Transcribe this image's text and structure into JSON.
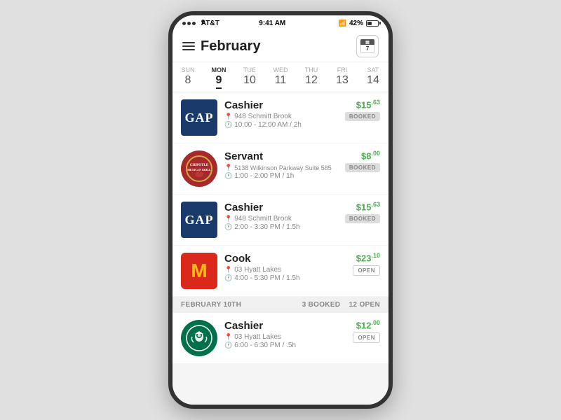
{
  "statusBar": {
    "carrier": "AT&T",
    "time": "9:41 AM",
    "bluetooth": "42%"
  },
  "header": {
    "title": "February",
    "calendarDay": "7"
  },
  "days": [
    {
      "label": "SUN",
      "num": "8",
      "active": false
    },
    {
      "label": "MON",
      "num": "9",
      "active": true
    },
    {
      "label": "TUE",
      "num": "10",
      "active": false
    },
    {
      "label": "WED",
      "num": "11",
      "active": false
    },
    {
      "label": "THU",
      "num": "12",
      "active": false
    },
    {
      "label": "FRI",
      "num": "13",
      "active": false
    },
    {
      "label": "SAT",
      "num": "14",
      "active": false
    }
  ],
  "jobs": [
    {
      "id": "gap-1",
      "logo": "gap",
      "title": "Cashier",
      "address": "948 Schmitt Brook",
      "time": "10:00 - 12:00 AM / 2h",
      "price": "$15",
      "cents": "63",
      "badge": "BOOKED",
      "badgeType": "booked"
    },
    {
      "id": "chipotle-1",
      "logo": "chipotle",
      "title": "Servant",
      "address": "5138 Wilkinson Parkway Suite 585",
      "time": "1:00 - 2:00 PM / 1h",
      "price": "$8",
      "cents": "00",
      "badge": "BOOKED",
      "badgeType": "booked"
    },
    {
      "id": "gap-2",
      "logo": "gap",
      "title": "Cashier",
      "address": "948 Schmitt Brook",
      "time": "2:00 - 3:30 PM / 1.5h",
      "price": "$15",
      "cents": "63",
      "badge": "BOOKED",
      "badgeType": "booked"
    },
    {
      "id": "mcdonalds-1",
      "logo": "mcdonalds",
      "title": "Cook",
      "address": "03 Hyatt Lakes",
      "time": "4:00 - 5:30 PM / 1.5h",
      "price": "$23",
      "cents": "10",
      "badge": "OPEN",
      "badgeType": "open"
    }
  ],
  "divider": {
    "label": "FEBRUARY 10TH",
    "booked": "3 BOOKED",
    "open": "12 OPEN"
  },
  "nextDayJobs": [
    {
      "id": "starbucks-1",
      "logo": "starbucks",
      "title": "Cashier",
      "address": "03 Hyatt Lakes",
      "time": "6:00 - 6:30 PM / .5h",
      "price": "$12",
      "cents": "00",
      "badge": "OPEN",
      "badgeType": "open"
    }
  ]
}
